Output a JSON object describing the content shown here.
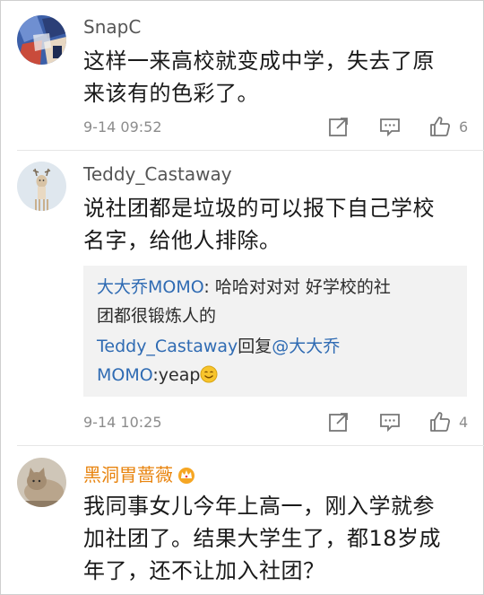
{
  "comments": [
    {
      "username": "SnapC",
      "text_lines": [
        "这样一来高校就变成中学，失去了原",
        "来该有的色彩了。"
      ],
      "timestamp": "9-14 09:52",
      "likes": "6",
      "avatar_icon": "blue-collage-avatar-icon"
    },
    {
      "username": "Teddy_Castaway",
      "text_lines": [
        "说社团都是垃圾的可以报下自己学校",
        "名字，给他人排除。"
      ],
      "timestamp": "9-14 10:25",
      "likes": "4",
      "avatar_icon": "deer-avatar-icon",
      "replies": [
        {
          "author": "大大乔MOMO",
          "sep": ":",
          "line1": " 哈哈对对对  好学校的社",
          "line2": "团都很锻炼人的"
        },
        {
          "author": "Teddy_Castaway",
          "verb": "回复",
          "mention1": "@大大乔",
          "mention2": "MOMO",
          "text": ":yeap",
          "emoji": "smile-emoji-icon"
        }
      ]
    },
    {
      "username": "黑洞胃蔷薇",
      "badge_icon": "crown-vip-icon",
      "text_lines": [
        "我同事女儿今年上高一，刚入学就参",
        "加社团了。结果大学生了，都18岁成",
        "年了，还不让加入社团？"
      ],
      "avatar_icon": "cat-avatar-icon"
    }
  ],
  "action_icons": [
    "share-icon",
    "comment-icon",
    "thumbs-up-icon"
  ],
  "colors": {
    "link": "#2f6bb3",
    "vip_name": "#e8840f",
    "meta": "#8c8c8c",
    "reply_bg": "#f2f2f2"
  }
}
